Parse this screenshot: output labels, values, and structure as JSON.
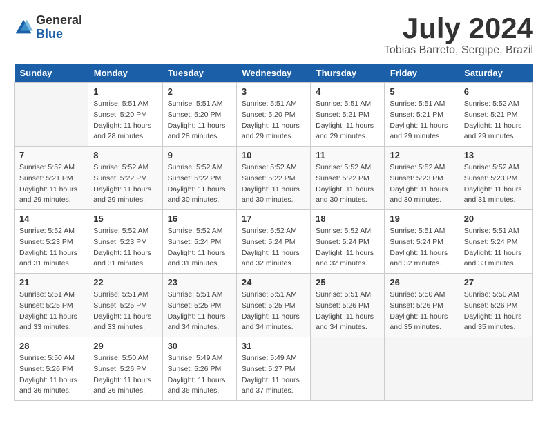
{
  "logo": {
    "general": "General",
    "blue": "Blue"
  },
  "title": "July 2024",
  "subtitle": "Tobias Barreto, Sergipe, Brazil",
  "headers": [
    "Sunday",
    "Monday",
    "Tuesday",
    "Wednesday",
    "Thursday",
    "Friday",
    "Saturday"
  ],
  "weeks": [
    [
      {
        "day": "",
        "info": ""
      },
      {
        "day": "1",
        "info": "Sunrise: 5:51 AM\nSunset: 5:20 PM\nDaylight: 11 hours\nand 28 minutes."
      },
      {
        "day": "2",
        "info": "Sunrise: 5:51 AM\nSunset: 5:20 PM\nDaylight: 11 hours\nand 28 minutes."
      },
      {
        "day": "3",
        "info": "Sunrise: 5:51 AM\nSunset: 5:20 PM\nDaylight: 11 hours\nand 29 minutes."
      },
      {
        "day": "4",
        "info": "Sunrise: 5:51 AM\nSunset: 5:21 PM\nDaylight: 11 hours\nand 29 minutes."
      },
      {
        "day": "5",
        "info": "Sunrise: 5:51 AM\nSunset: 5:21 PM\nDaylight: 11 hours\nand 29 minutes."
      },
      {
        "day": "6",
        "info": "Sunrise: 5:52 AM\nSunset: 5:21 PM\nDaylight: 11 hours\nand 29 minutes."
      }
    ],
    [
      {
        "day": "7",
        "info": "Sunrise: 5:52 AM\nSunset: 5:21 PM\nDaylight: 11 hours\nand 29 minutes."
      },
      {
        "day": "8",
        "info": "Sunrise: 5:52 AM\nSunset: 5:22 PM\nDaylight: 11 hours\nand 29 minutes."
      },
      {
        "day": "9",
        "info": "Sunrise: 5:52 AM\nSunset: 5:22 PM\nDaylight: 11 hours\nand 30 minutes."
      },
      {
        "day": "10",
        "info": "Sunrise: 5:52 AM\nSunset: 5:22 PM\nDaylight: 11 hours\nand 30 minutes."
      },
      {
        "day": "11",
        "info": "Sunrise: 5:52 AM\nSunset: 5:22 PM\nDaylight: 11 hours\nand 30 minutes."
      },
      {
        "day": "12",
        "info": "Sunrise: 5:52 AM\nSunset: 5:23 PM\nDaylight: 11 hours\nand 30 minutes."
      },
      {
        "day": "13",
        "info": "Sunrise: 5:52 AM\nSunset: 5:23 PM\nDaylight: 11 hours\nand 31 minutes."
      }
    ],
    [
      {
        "day": "14",
        "info": "Sunrise: 5:52 AM\nSunset: 5:23 PM\nDaylight: 11 hours\nand 31 minutes."
      },
      {
        "day": "15",
        "info": "Sunrise: 5:52 AM\nSunset: 5:23 PM\nDaylight: 11 hours\nand 31 minutes."
      },
      {
        "day": "16",
        "info": "Sunrise: 5:52 AM\nSunset: 5:24 PM\nDaylight: 11 hours\nand 31 minutes."
      },
      {
        "day": "17",
        "info": "Sunrise: 5:52 AM\nSunset: 5:24 PM\nDaylight: 11 hours\nand 32 minutes."
      },
      {
        "day": "18",
        "info": "Sunrise: 5:52 AM\nSunset: 5:24 PM\nDaylight: 11 hours\nand 32 minutes."
      },
      {
        "day": "19",
        "info": "Sunrise: 5:51 AM\nSunset: 5:24 PM\nDaylight: 11 hours\nand 32 minutes."
      },
      {
        "day": "20",
        "info": "Sunrise: 5:51 AM\nSunset: 5:24 PM\nDaylight: 11 hours\nand 33 minutes."
      }
    ],
    [
      {
        "day": "21",
        "info": "Sunrise: 5:51 AM\nSunset: 5:25 PM\nDaylight: 11 hours\nand 33 minutes."
      },
      {
        "day": "22",
        "info": "Sunrise: 5:51 AM\nSunset: 5:25 PM\nDaylight: 11 hours\nand 33 minutes."
      },
      {
        "day": "23",
        "info": "Sunrise: 5:51 AM\nSunset: 5:25 PM\nDaylight: 11 hours\nand 34 minutes."
      },
      {
        "day": "24",
        "info": "Sunrise: 5:51 AM\nSunset: 5:25 PM\nDaylight: 11 hours\nand 34 minutes."
      },
      {
        "day": "25",
        "info": "Sunrise: 5:51 AM\nSunset: 5:26 PM\nDaylight: 11 hours\nand 34 minutes."
      },
      {
        "day": "26",
        "info": "Sunrise: 5:50 AM\nSunset: 5:26 PM\nDaylight: 11 hours\nand 35 minutes."
      },
      {
        "day": "27",
        "info": "Sunrise: 5:50 AM\nSunset: 5:26 PM\nDaylight: 11 hours\nand 35 minutes."
      }
    ],
    [
      {
        "day": "28",
        "info": "Sunrise: 5:50 AM\nSunset: 5:26 PM\nDaylight: 11 hours\nand 36 minutes."
      },
      {
        "day": "29",
        "info": "Sunrise: 5:50 AM\nSunset: 5:26 PM\nDaylight: 11 hours\nand 36 minutes."
      },
      {
        "day": "30",
        "info": "Sunrise: 5:49 AM\nSunset: 5:26 PM\nDaylight: 11 hours\nand 36 minutes."
      },
      {
        "day": "31",
        "info": "Sunrise: 5:49 AM\nSunset: 5:27 PM\nDaylight: 11 hours\nand 37 minutes."
      },
      {
        "day": "",
        "info": ""
      },
      {
        "day": "",
        "info": ""
      },
      {
        "day": "",
        "info": ""
      }
    ]
  ]
}
